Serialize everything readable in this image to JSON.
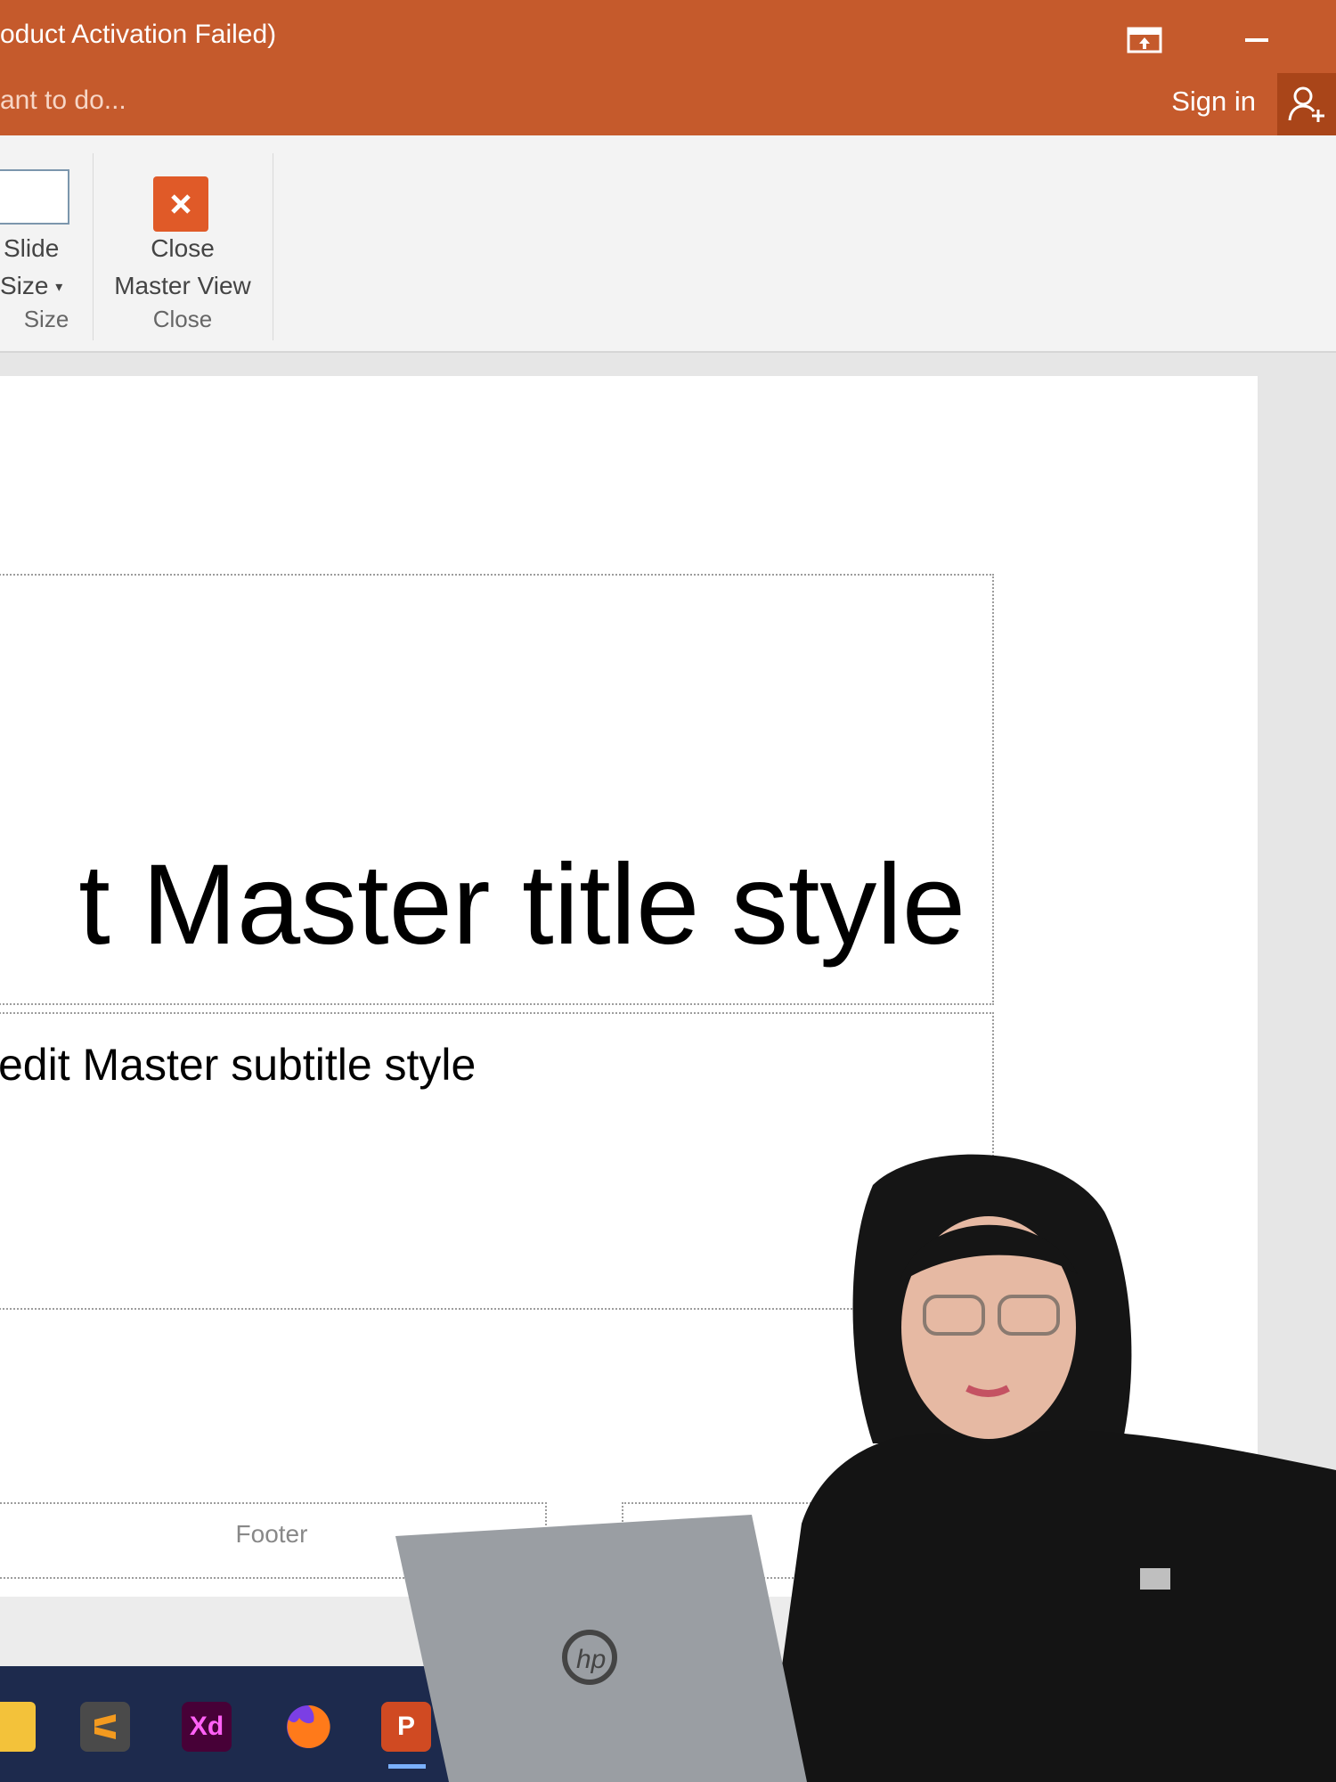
{
  "window": {
    "title": "oduct Activation Failed)",
    "tell_me": "ant to do...",
    "sign_in": "Sign in",
    "accent_color": "#c55a2c"
  },
  "ribbon": {
    "groups": [
      {
        "label": "Size",
        "command": {
          "line1": "Slide",
          "line2": "Size",
          "icon": "slide-size-icon"
        }
      },
      {
        "label": "Close",
        "command": {
          "line1": "Close",
          "line2": "Master View",
          "icon": "close-master-view-icon"
        }
      }
    ]
  },
  "slide": {
    "title_placeholder": "t Master title style",
    "subtitle_placeholder": "edit Master subtitle style",
    "footer_placeholder": "Footer"
  },
  "taskbar": {
    "apps": [
      {
        "name": "file-explorer-icon"
      },
      {
        "name": "sublime-text-icon"
      },
      {
        "name": "adobe-xd-icon",
        "label": "Xd"
      },
      {
        "name": "firefox-icon"
      },
      {
        "name": "powerpoint-icon",
        "label": "P"
      }
    ]
  }
}
